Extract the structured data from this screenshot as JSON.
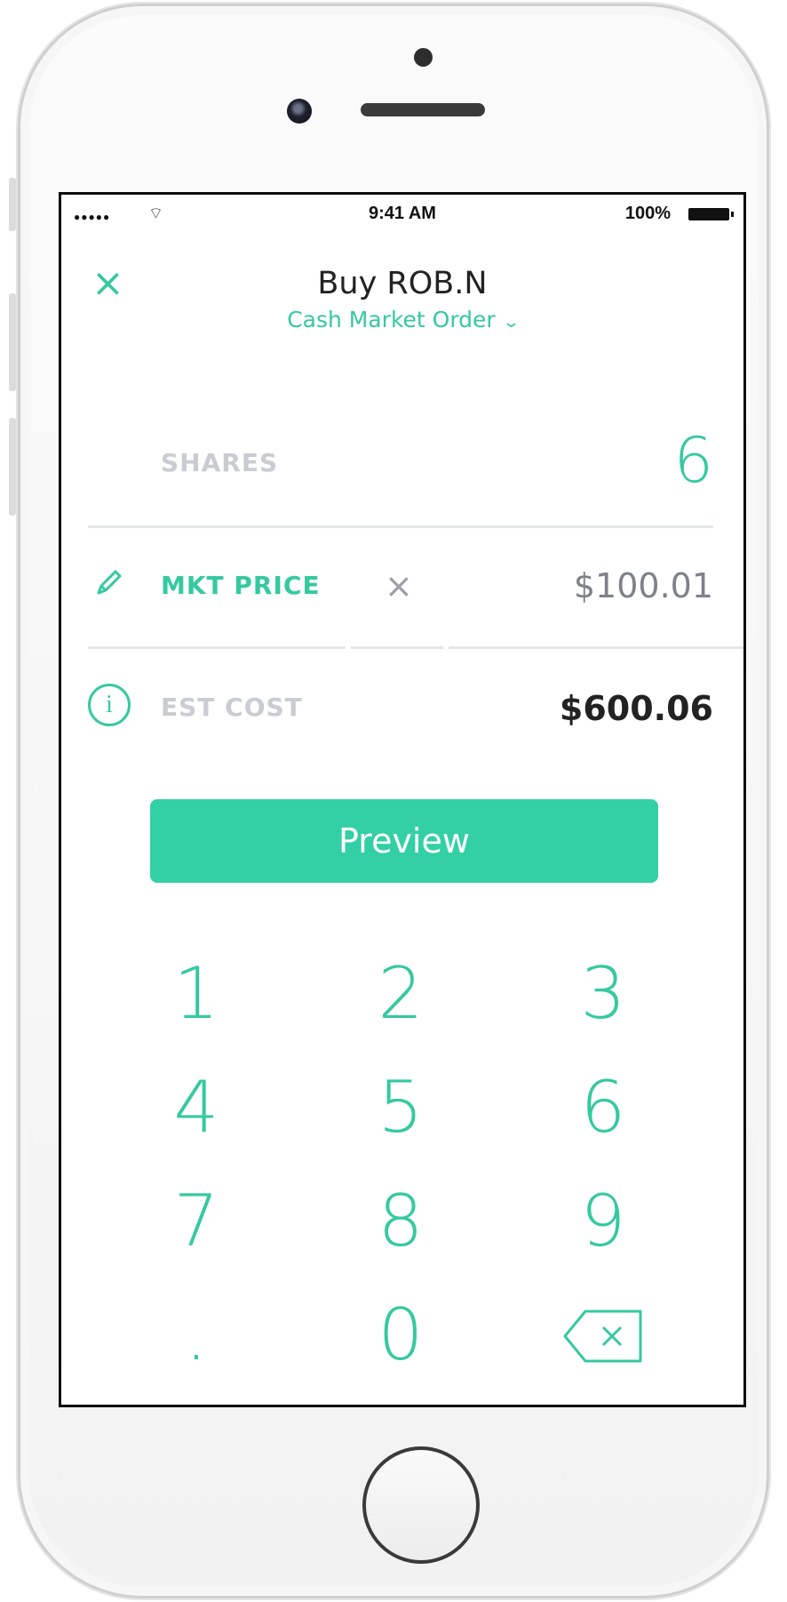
{
  "status_bar": {
    "signal": "●●●●●",
    "wifi": "⌔",
    "time": "9:41 AM",
    "battery": "100%"
  },
  "header": {
    "title": "Buy ROB.N",
    "subtitle": "Cash Market Order",
    "close_icon": "×",
    "dropdown_icon": "⌄"
  },
  "order": {
    "shares_label": "SHARES",
    "shares_value": "6",
    "price_label": "MKT PRICE",
    "price_clear_icon": "×",
    "price_value": "$100.01",
    "est_cost_label": "EST COST",
    "est_cost_value": "$600.06",
    "info_icon": "i"
  },
  "preview_button": "Preview",
  "keypad": {
    "k1": "1",
    "k2": "2",
    "k3": "3",
    "k4": "4",
    "k5": "5",
    "k6": "6",
    "k7": "7",
    "k8": "8",
    "k9": "9",
    "kdot": ".",
    "k0": "0"
  },
  "colors": {
    "accent": "#35c9a0",
    "button": "#33cfa5",
    "muted": "#c9ccd1",
    "text": "#222222"
  },
  "icons": [
    "close-icon",
    "chevron-down-icon",
    "pencil-icon",
    "clear-icon",
    "info-icon",
    "backspace-icon",
    "wifi-icon",
    "battery-icon"
  ]
}
